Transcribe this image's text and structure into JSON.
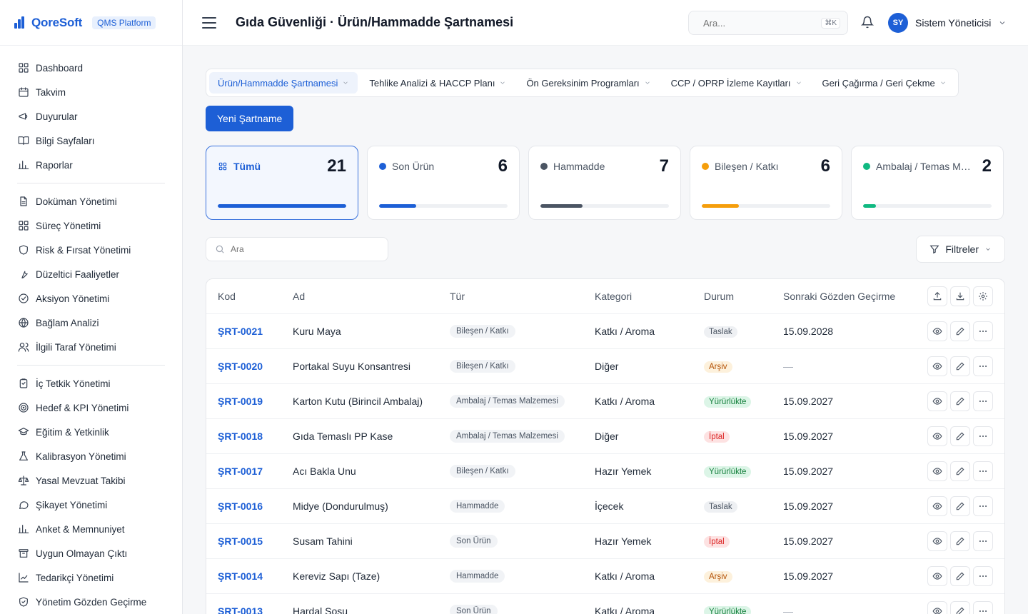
{
  "brand": {
    "name": "QoreSoft",
    "tag": "QMS Platform"
  },
  "header": {
    "title": "Gıda Güvenliği · Ürün/Hammadde Şartnamesi",
    "search_placeholder": "Ara...",
    "search_shortcut": "⌘K",
    "user_initials": "SY",
    "user_name": "Sistem Yöneticisi"
  },
  "sidebar": {
    "group1": [
      {
        "label": "Dashboard",
        "icon": "grid-icon"
      },
      {
        "label": "Takvim",
        "icon": "calendar-icon"
      },
      {
        "label": "Duyurular",
        "icon": "megaphone-icon"
      },
      {
        "label": "Bilgi Sayfaları",
        "icon": "book-icon"
      },
      {
        "label": "Raporlar",
        "icon": "bar-chart-icon"
      }
    ],
    "group2": [
      {
        "label": "Doküman Yönetimi",
        "icon": "document-icon"
      },
      {
        "label": "Süreç Yönetimi",
        "icon": "grid-icon"
      },
      {
        "label": "Risk & Fırsat Yönetimi",
        "icon": "shield-icon"
      },
      {
        "label": "Düzeltici Faaliyetler",
        "icon": "wrench-icon"
      },
      {
        "label": "Aksiyon Yönetimi",
        "icon": "check-circle-icon"
      },
      {
        "label": "Bağlam Analizi",
        "icon": "globe-icon"
      },
      {
        "label": "İlgili Taraf Yönetimi",
        "icon": "users-icon"
      }
    ],
    "group3": [
      {
        "label": "İç Tetkik Yönetimi",
        "icon": "clipboard-icon"
      },
      {
        "label": "Hedef & KPI Yönetimi",
        "icon": "target-icon"
      },
      {
        "label": "Eğitim & Yetkinlik",
        "icon": "graduation-icon"
      },
      {
        "label": "Kalibrasyon Yönetimi",
        "icon": "flask-icon"
      },
      {
        "label": "Yasal Mevzuat Takibi",
        "icon": "scale-icon"
      },
      {
        "label": "Şikayet Yönetimi",
        "icon": "message-icon"
      },
      {
        "label": "Anket & Memnuniyet",
        "icon": "bar-chart-icon"
      },
      {
        "label": "Uygun Olmayan Çıktı",
        "icon": "archive-icon"
      },
      {
        "label": "Tedarikçi Yönetimi",
        "icon": "chart-icon"
      },
      {
        "label": "Yönetim Gözden Geçirme",
        "icon": "shield-check-icon"
      }
    ]
  },
  "tabs": [
    {
      "label": "Ürün/Hammadde Şartnamesi",
      "active": true
    },
    {
      "label": "Tehlike Analizi & HACCP Planı",
      "active": false
    },
    {
      "label": "Ön Gereksinim Programları",
      "active": false
    },
    {
      "label": "CCP / OPRP İzleme Kayıtları",
      "active": false
    },
    {
      "label": "Geri Çağırma / Geri Çekme",
      "active": false
    }
  ],
  "new_button": "Yeni Şartname",
  "stats": [
    {
      "label": "Tümü",
      "count": "21",
      "progress": 1.0,
      "color": "#1d5fd6",
      "active": true
    },
    {
      "label": "Son Ürün",
      "count": "6",
      "progress": 0.29,
      "color": "#1d5fd6",
      "active": false
    },
    {
      "label": "Hammadde",
      "count": "7",
      "progress": 0.33,
      "color": "#4b5563",
      "active": false
    },
    {
      "label": "Bileşen / Katkı",
      "count": "6",
      "progress": 0.29,
      "color": "#f59e0b",
      "active": false
    },
    {
      "label": "Ambalaj / Temas Malzemesi",
      "count": "2",
      "progress": 0.1,
      "color": "#10b981",
      "active": false
    }
  ],
  "table_search_placeholder": "Ara",
  "filter_label": "Filtreler",
  "table": {
    "columns": [
      "Kod",
      "Ad",
      "Tür",
      "Kategori",
      "Durum",
      "Sonraki Gözden Geçirme"
    ],
    "rows": [
      {
        "code": "ŞRT-0021",
        "name": "Kuru Maya",
        "type": "Bileşen / Katkı",
        "category": "Katkı / Aroma",
        "status": "Taslak",
        "review": "15.09.2028"
      },
      {
        "code": "ŞRT-0020",
        "name": "Portakal Suyu Konsantresi",
        "type": "Bileşen / Katkı",
        "category": "Diğer",
        "status": "Arşiv",
        "review": "—"
      },
      {
        "code": "ŞRT-0019",
        "name": "Karton Kutu (Birincil Ambalaj)",
        "type": "Ambalaj / Temas Malzemesi",
        "category": "Katkı / Aroma",
        "status": "Yürürlükte",
        "review": "15.09.2027"
      },
      {
        "code": "ŞRT-0018",
        "name": "Gıda Temaslı PP Kase",
        "type": "Ambalaj / Temas Malzemesi",
        "category": "Diğer",
        "status": "İptal",
        "review": "15.09.2027"
      },
      {
        "code": "ŞRT-0017",
        "name": "Acı Bakla Unu",
        "type": "Bileşen / Katkı",
        "category": "Hazır Yemek",
        "status": "Yürürlükte",
        "review": "15.09.2027"
      },
      {
        "code": "ŞRT-0016",
        "name": "Midye (Dondurulmuş)",
        "type": "Hammadde",
        "category": "İçecek",
        "status": "Taslak",
        "review": "15.09.2027"
      },
      {
        "code": "ŞRT-0015",
        "name": "Susam Tahini",
        "type": "Son Ürün",
        "category": "Hazır Yemek",
        "status": "İptal",
        "review": "15.09.2027"
      },
      {
        "code": "ŞRT-0014",
        "name": "Kereviz Sapı (Taze)",
        "type": "Hammadde",
        "category": "Katkı / Aroma",
        "status": "Arşiv",
        "review": "15.09.2027"
      },
      {
        "code": "ŞRT-0013",
        "name": "Hardal Sosu",
        "type": "Son Ürün",
        "category": "Katkı / Aroma",
        "status": "Yürürlükte",
        "review": "—"
      }
    ]
  },
  "status_colors": {
    "Taslak": {
      "bg": "#eef0f3",
      "fg": "#4b5563"
    },
    "Arşiv": {
      "bg": "#fdf1dc",
      "fg": "#b45309"
    },
    "Yürürlükte": {
      "bg": "#dcf5e7",
      "fg": "#15803d"
    },
    "İptal": {
      "bg": "#fde2e2",
      "fg": "#dc2626"
    }
  }
}
